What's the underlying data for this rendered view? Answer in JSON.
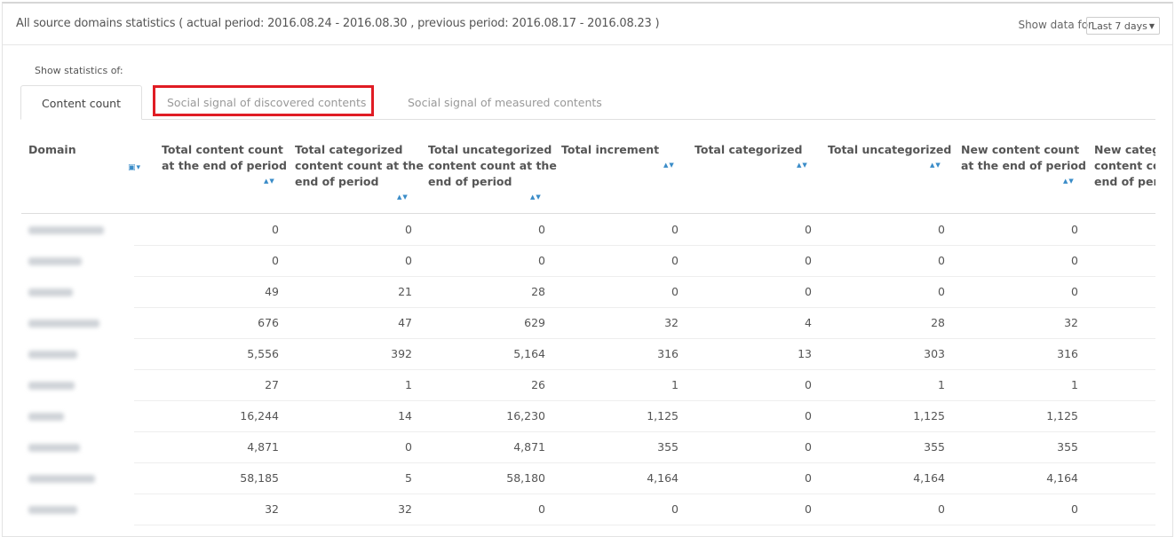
{
  "header": {
    "title": "All source domains statistics ( actual period: 2016.08.24 - 2016.08.30 , previous period: 2016.08.17 - 2016.08.23 )",
    "show_data_for": "Show data for",
    "period_select": "Last 7 days"
  },
  "stats_label": "Show statistics of:",
  "tabs": [
    {
      "label": "Content count",
      "active": true
    },
    {
      "label": "Social signal of discovered contents",
      "highlighted": true
    },
    {
      "label": "Social signal of measured contents"
    }
  ],
  "highlight_color": "#e01c24",
  "columns": [
    "Domain",
    "Total content count at the end of period",
    "Total categorized content count at the end of period",
    "Total uncategorized content count at the end of period",
    "Total increment",
    "Total categorized",
    "Total uncategorized",
    "New content count at the end of period",
    "New categorized content count at the end of period"
  ],
  "rows": [
    [
      "0",
      "0",
      "0",
      "0",
      "0",
      "0",
      "0"
    ],
    [
      "0",
      "0",
      "0",
      "0",
      "0",
      "0",
      "0"
    ],
    [
      "49",
      "21",
      "28",
      "0",
      "0",
      "0",
      "0"
    ],
    [
      "676",
      "47",
      "629",
      "32",
      "4",
      "28",
      "32"
    ],
    [
      "5,556",
      "392",
      "5,164",
      "316",
      "13",
      "303",
      "316"
    ],
    [
      "27",
      "1",
      "26",
      "1",
      "0",
      "1",
      "1"
    ],
    [
      "16,244",
      "14",
      "16,230",
      "1,125",
      "0",
      "1,125",
      "1,125"
    ],
    [
      "4,871",
      "0",
      "4,871",
      "355",
      "0",
      "355",
      "355"
    ],
    [
      "58,185",
      "5",
      "58,180",
      "4,164",
      "0",
      "4,164",
      "4,164"
    ],
    [
      "32",
      "32",
      "0",
      "0",
      "0",
      "0",
      "0"
    ]
  ]
}
